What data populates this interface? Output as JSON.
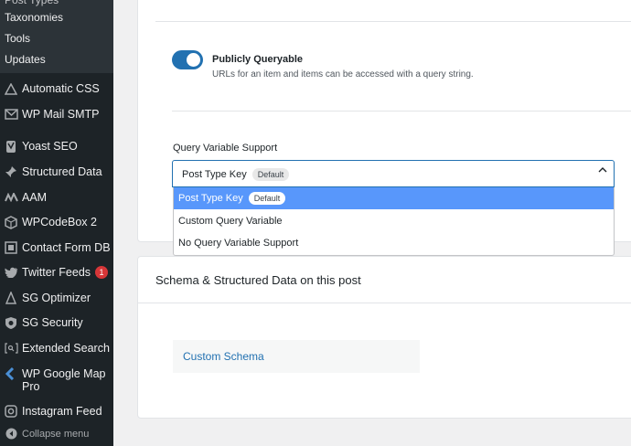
{
  "sidebar": {
    "cut_item": "Taxonomies",
    "submenu": [
      {
        "label": "Taxonomies"
      },
      {
        "label": "Tools"
      },
      {
        "label": "Updates"
      }
    ],
    "items": [
      {
        "label": "Automatic CSS",
        "icon": "triangle-icon"
      },
      {
        "label": "WP Mail SMTP",
        "icon": "mail-icon"
      },
      {
        "label": "Yoast SEO",
        "icon": "yoast-icon"
      },
      {
        "label": "Structured Data",
        "icon": "pin-icon"
      },
      {
        "label": "AAM",
        "icon": "aam-icon"
      },
      {
        "label": "WPCodeBox 2",
        "icon": "cube-icon"
      },
      {
        "label": "Contact Form DB",
        "icon": "db-icon"
      },
      {
        "label": "Twitter Feeds",
        "icon": "twitter-icon",
        "badge": "1"
      },
      {
        "label": "SG Optimizer",
        "icon": "sg-icon"
      },
      {
        "label": "SG Security",
        "icon": "shield-icon"
      },
      {
        "label": "Extended Search",
        "icon": "search-bracket-icon"
      },
      {
        "label": "WP Google Map Pro",
        "icon": "map-icon"
      },
      {
        "label": "Instagram Feed",
        "icon": "instagram-icon"
      }
    ],
    "collapse": "Collapse menu"
  },
  "settings": {
    "toggle_title": "Publicly Queryable",
    "toggle_desc": "URLs for an item and items can be accessed with a query string.",
    "toggle_on": true,
    "query_label": "Query Variable Support",
    "select_value": "Post Type Key",
    "select_chip": "Default",
    "options": [
      {
        "label": "Post Type Key",
        "chip": "Default",
        "selected": true
      },
      {
        "label": "Custom Query Variable"
      },
      {
        "label": "No Query Variable Support"
      }
    ]
  },
  "schema": {
    "title": "Schema & Structured Data on this post",
    "custom_label": "Custom Schema"
  },
  "colors": {
    "accent": "#2271b1",
    "selected": "#5897fb",
    "badge": "#d63638"
  }
}
